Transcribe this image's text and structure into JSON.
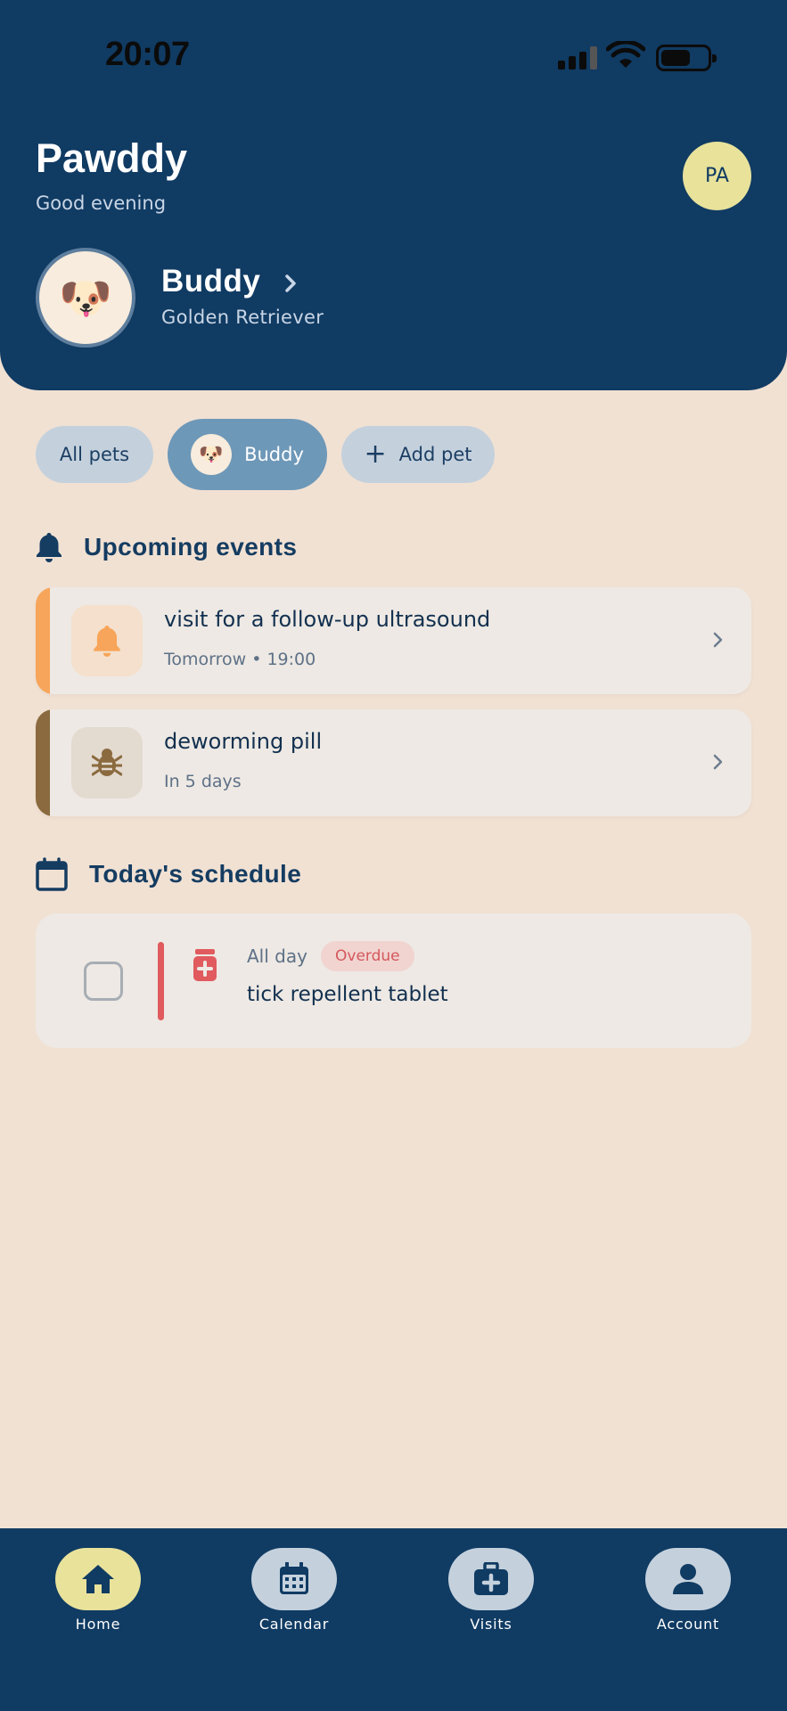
{
  "status_bar": {
    "time": "20:07"
  },
  "header": {
    "app_title": "Pawddy",
    "greeting": "Good evening",
    "avatar_initials": "PA",
    "pet": {
      "emoji": "🐶",
      "name": "Buddy",
      "breed": "Golden Retriever"
    }
  },
  "filters": {
    "all_label": "All pets",
    "pet_label": "Buddy",
    "pet_emoji": "🐶",
    "add_label": "Add pet"
  },
  "upcoming": {
    "title": "Upcoming events",
    "events": [
      {
        "title": "visit for a follow-up ultrasound",
        "subtitle": "Tomorrow • 19:00",
        "icon": "bell-icon",
        "accent": "#F7A55A"
      },
      {
        "title": "deworming pill",
        "subtitle": "In 5 days",
        "icon": "bug-icon",
        "accent": "#8A6A3E"
      }
    ]
  },
  "schedule": {
    "title": "Today's schedule",
    "items": [
      {
        "time": "All day",
        "status": "Overdue",
        "title": "tick repellent tablet",
        "icon": "medicine-icon"
      }
    ]
  },
  "nav": {
    "items": [
      {
        "label": "Home",
        "icon": "home-icon",
        "active": true
      },
      {
        "label": "Calendar",
        "icon": "calendar-icon",
        "active": false
      },
      {
        "label": "Visits",
        "icon": "medical-kit-icon",
        "active": false
      },
      {
        "label": "Account",
        "icon": "account-icon",
        "active": false
      }
    ]
  },
  "colors": {
    "primary": "#103B63",
    "background": "#F1E1D3",
    "accent_yellow": "#E8E29B",
    "overdue_red": "#E05A5E"
  }
}
